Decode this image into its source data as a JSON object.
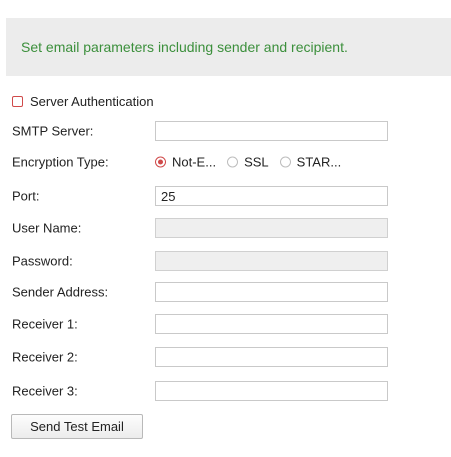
{
  "banner": {
    "text": "Set email parameters including sender and recipient."
  },
  "server_auth": {
    "label": "Server Authentication",
    "checked": false
  },
  "fields": {
    "smtp_server": {
      "label": "SMTP Server:",
      "value": ""
    },
    "encryption": {
      "label": "Encryption Type:",
      "options": [
        "Not-E...",
        "SSL",
        "STAR..."
      ],
      "selected": "Not-E..."
    },
    "port": {
      "label": "Port:",
      "value": "25"
    },
    "user_name": {
      "label": "User Name:",
      "value": "",
      "disabled": true
    },
    "password": {
      "label": "Password:",
      "value": "",
      "disabled": true
    },
    "sender_address": {
      "label": "Sender Address:",
      "value": ""
    },
    "receiver_1": {
      "label": "Receiver 1:",
      "value": ""
    },
    "receiver_2": {
      "label": "Receiver 2:",
      "value": ""
    },
    "receiver_3": {
      "label": "Receiver 3:",
      "value": ""
    }
  },
  "actions": {
    "send_test_email": "Send Test Email"
  },
  "colors": {
    "accent": "#d04a4a",
    "banner_text": "#3b8f3b",
    "banner_bg": "#ececec"
  }
}
